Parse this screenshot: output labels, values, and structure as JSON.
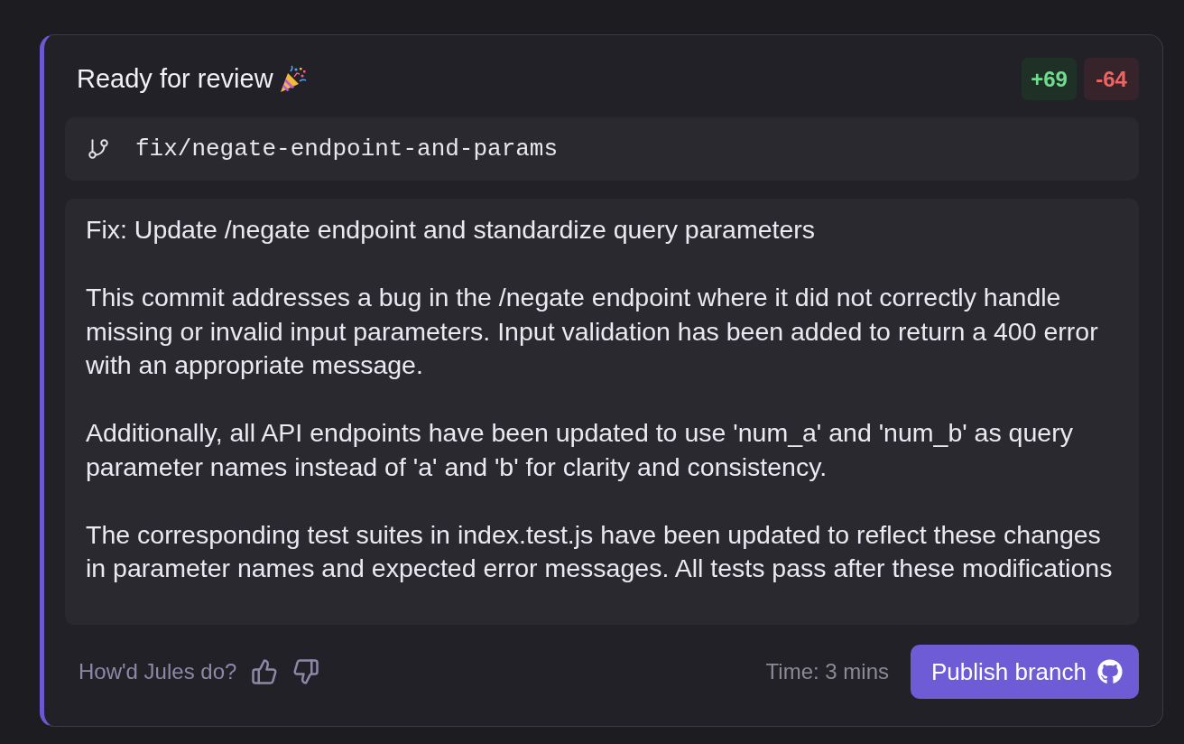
{
  "card": {
    "title": "Ready for review",
    "additions": "+69",
    "deletions": "-64",
    "branch": "fix/negate-endpoint-and-params",
    "commit_message": [
      "Fix: Update /negate endpoint and standardize query parameters",
      "This commit addresses a bug in the /negate endpoint where it did not correctly handle missing or invalid input parameters. Input validation has been added to return a 400 error with an appropriate message.",
      "Additionally, all API endpoints have been updated to use 'num_a' and 'num_b' as query parameter names instead of 'a' and 'b' for clarity and consistency.",
      "The corresponding test suites in index.test.js have been updated to reflect these changes in parameter names and expected error messages. All tests pass after these modifications"
    ]
  },
  "footer": {
    "feedback_prompt": "How'd Jules do?",
    "time": "Time: 3 mins",
    "publish_button": "Publish branch"
  }
}
